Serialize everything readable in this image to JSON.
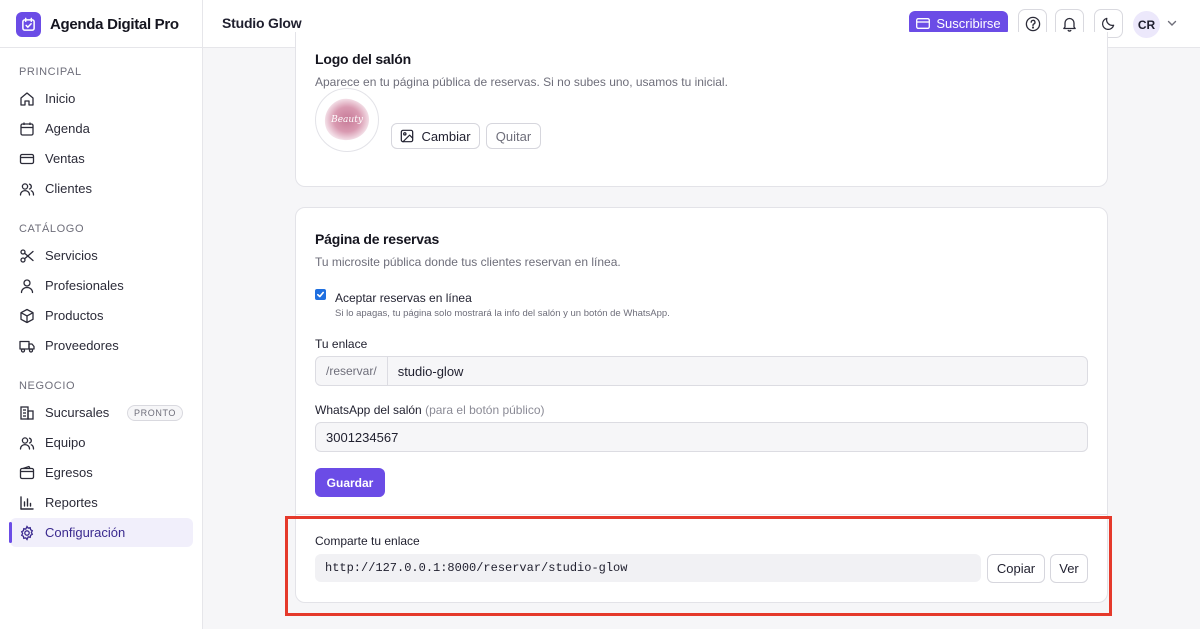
{
  "brand": {
    "name": "Agenda Digital Pro"
  },
  "header": {
    "salon_name": "Studio Glow",
    "subscribe_label": "Suscribirse",
    "user_initials": "CR"
  },
  "sidebar": {
    "sections": [
      {
        "title": "PRINCIPAL",
        "items": [
          {
            "label": "Inicio",
            "icon": "home-icon"
          },
          {
            "label": "Agenda",
            "icon": "calendar-icon"
          },
          {
            "label": "Ventas",
            "icon": "card-icon"
          },
          {
            "label": "Clientes",
            "icon": "users-icon"
          }
        ]
      },
      {
        "title": "CATÁLOGO",
        "items": [
          {
            "label": "Servicios",
            "icon": "scissors-icon"
          },
          {
            "label": "Profesionales",
            "icon": "user-icon"
          },
          {
            "label": "Productos",
            "icon": "box-icon"
          },
          {
            "label": "Proveedores",
            "icon": "truck-icon"
          }
        ]
      },
      {
        "title": "NEGOCIO",
        "items": [
          {
            "label": "Sucursales",
            "icon": "building-icon",
            "badge": "PRONTO"
          },
          {
            "label": "Equipo",
            "icon": "team-icon"
          },
          {
            "label": "Egresos",
            "icon": "wallet-icon"
          },
          {
            "label": "Reportes",
            "icon": "chart-icon"
          },
          {
            "label": "Configuración",
            "icon": "gear-icon",
            "active": true
          }
        ]
      }
    ]
  },
  "logo_card": {
    "title": "Logo del salón",
    "subtitle": "Aparece en tu página pública de reservas. Si no subes uno, usamos tu inicial.",
    "logo_text": "Beauty",
    "change_label": "Cambiar",
    "remove_label": "Quitar"
  },
  "booking_card": {
    "title": "Página de reservas",
    "subtitle": "Tu microsite pública donde tus clientes reservan en línea.",
    "accept_label": "Aceptar reservas en línea",
    "accept_checked": true,
    "accept_help": "Si lo apagas, tu página solo mostrará la info del salón y un botón de WhatsApp.",
    "link_label": "Tu enlace",
    "link_prefix": "/reservar/",
    "link_value": "studio-glow",
    "whatsapp_label": "WhatsApp del salón",
    "whatsapp_hint": "(para el botón público)",
    "whatsapp_value": "3001234567",
    "save_label": "Guardar",
    "share_label": "Comparte tu enlace",
    "share_url": "http://127.0.0.1:8000/reservar/studio-glow",
    "copy_label": "Copiar",
    "view_label": "Ver"
  },
  "colors": {
    "accent": "#6b4ce6",
    "highlight": "#e5392b"
  }
}
